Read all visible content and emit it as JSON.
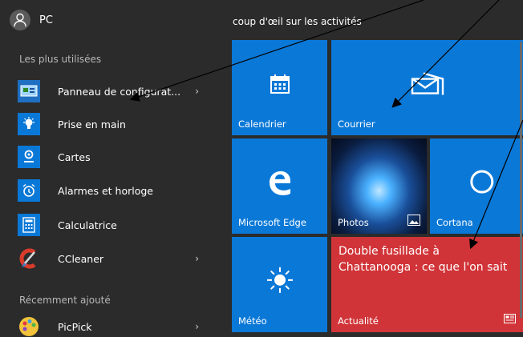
{
  "user": {
    "name": "PC"
  },
  "sections": {
    "most_used": "Les plus utilisées",
    "recent": "Récemment ajouté"
  },
  "apps": [
    {
      "label": "Panneau de configurat...",
      "icon": "control-panel-icon"
    },
    {
      "label": "Prise en main",
      "icon": "lightbulb-icon"
    },
    {
      "label": "Cartes",
      "icon": "maps-icon"
    },
    {
      "label": "Alarmes et horloge",
      "icon": "alarm-clock-icon"
    },
    {
      "label": "Calculatrice",
      "icon": "calculator-icon"
    },
    {
      "label": "CCleaner",
      "icon": "ccleaner-icon"
    }
  ],
  "recent_apps": [
    {
      "label": "PicPick",
      "icon": "picpick-icon"
    }
  ],
  "tiles_header": "coup d'œil sur les activités",
  "tiles": {
    "calendar": "Calendrier",
    "mail": "Courrier",
    "edge": "Microsoft Edge",
    "photos": "Photos",
    "cortana": "Cortana",
    "weather": "Météo",
    "news_headline": "Double fusillade à Chattanooga : ce que l'on sait",
    "news": "Actualité"
  },
  "colors": {
    "tile_blue": "#0a78d7",
    "news_red": "#d13438",
    "background": "#2b2b2b"
  }
}
